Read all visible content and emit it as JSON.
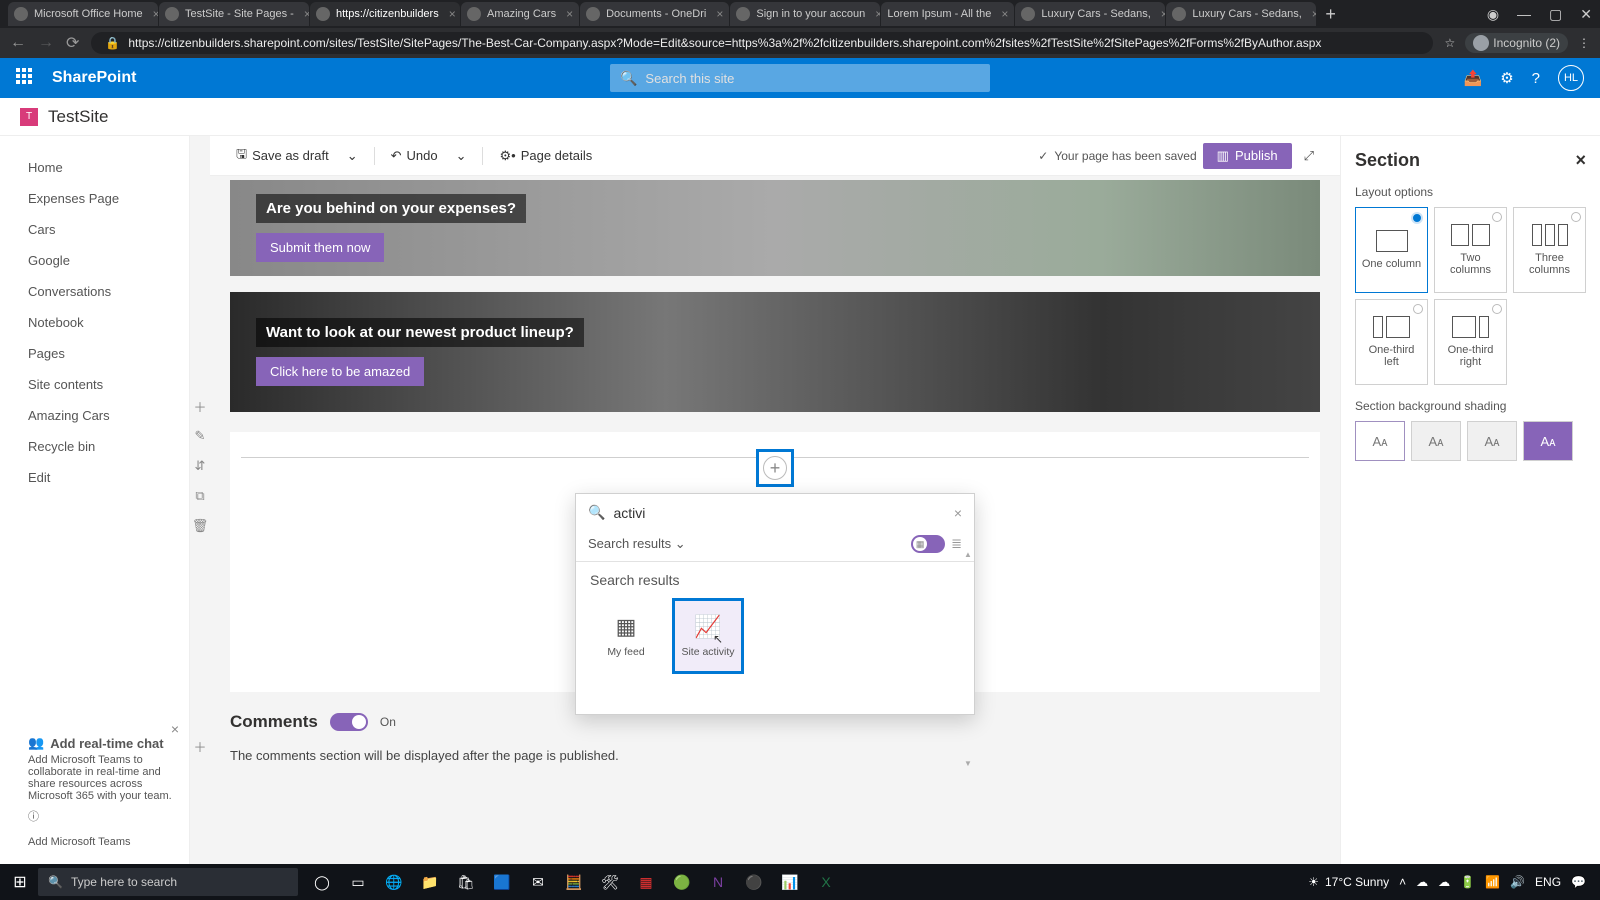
{
  "browser": {
    "tabs": [
      {
        "label": "Microsoft Office Home"
      },
      {
        "label": "TestSite - Site Pages -"
      },
      {
        "label": "https://citizenbuilders"
      },
      {
        "label": "Amazing Cars"
      },
      {
        "label": "Documents - OneDri"
      },
      {
        "label": "Sign in to your accoun"
      },
      {
        "label": "Lorem Ipsum - All the"
      },
      {
        "label": "Luxury Cars - Sedans,"
      },
      {
        "label": "Luxury Cars - Sedans,"
      }
    ],
    "active_tab_index": 2,
    "url": "https://citizenbuilders.sharepoint.com/sites/TestSite/SitePages/The-Best-Car-Company.aspx?Mode=Edit&source=https%3a%2f%2fcitizenbuilders.sharepoint.com%2fsites%2fTestSite%2fSitePages%2fForms%2fByAuthor.aspx",
    "incognito_label": "Incognito (2)"
  },
  "sp_header": {
    "brand": "SharePoint",
    "search_placeholder": "Search this site",
    "avatar": "HL"
  },
  "site": {
    "name": "TestSite"
  },
  "leftnav": {
    "items": [
      "Home",
      "Expenses Page",
      "Cars",
      "Google",
      "Conversations",
      "Notebook",
      "Pages",
      "Site contents",
      "Amazing Cars",
      "Recycle bin",
      "Edit"
    ]
  },
  "teams_promo": {
    "title": "Add real-time chat",
    "body": "Add Microsoft Teams to collaborate in real-time and share resources across Microsoft 365 with your team.",
    "link": "Add Microsoft Teams"
  },
  "cmdbar": {
    "save": "Save as draft",
    "undo": "Undo",
    "details": "Page details",
    "saved": "Your page has been saved",
    "publish": "Publish"
  },
  "heroes": [
    {
      "question": "Are you behind on your expenses?",
      "button": "Submit them now"
    },
    {
      "question": "Want to look at our newest product lineup?",
      "button": "Click here to be amazed"
    }
  ],
  "picker": {
    "search_value": "activi",
    "filter_label": "Search results",
    "section_label": "Search results",
    "items": [
      {
        "name": "My feed"
      },
      {
        "name": "Site activity"
      }
    ],
    "selected_index": 1
  },
  "comments": {
    "title": "Comments",
    "state": "On",
    "note": "The comments section will be displayed after the page is published."
  },
  "props_panel": {
    "title": "Section",
    "layout_label": "Layout options",
    "layouts": [
      "One column",
      "Two columns",
      "Three columns",
      "One-third left",
      "One-third right"
    ],
    "selected_layout": 0,
    "bg_label": "Section background shading"
  },
  "taskbar": {
    "search_placeholder": "Type here to search",
    "weather": "17°C  Sunny",
    "time": "",
    "lang": "ENG"
  }
}
